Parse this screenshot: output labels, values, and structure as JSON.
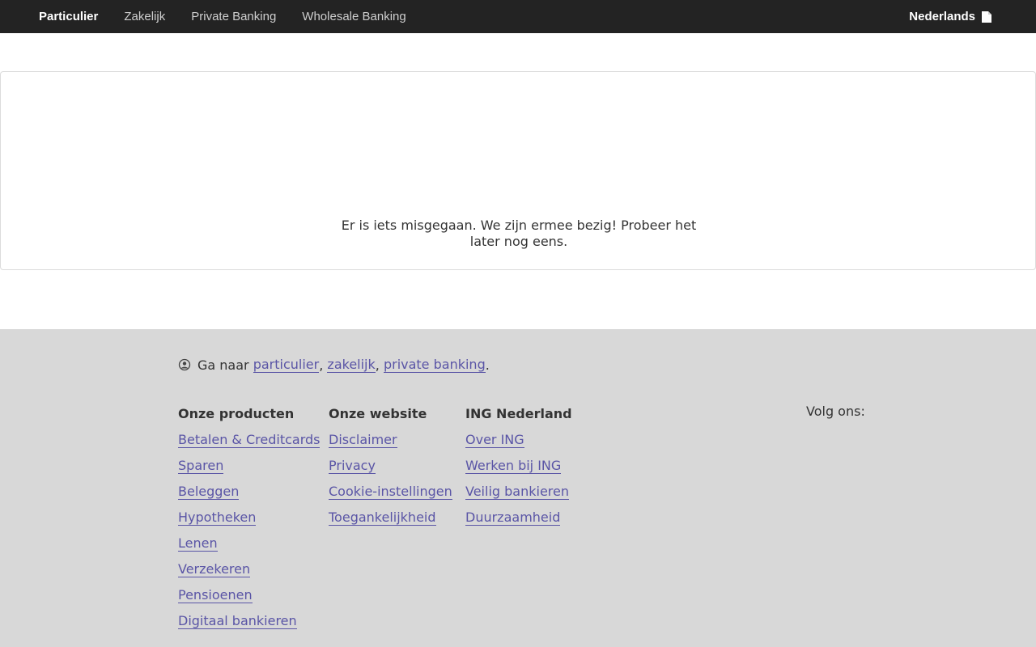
{
  "topnav": {
    "items": [
      {
        "label": "Particulier",
        "active": true
      },
      {
        "label": "Zakelijk"
      },
      {
        "label": "Private Banking"
      },
      {
        "label": "Wholesale Banking"
      }
    ],
    "language": "Nederlands",
    "language_icon": "flag-icon"
  },
  "error": {
    "message": "Er is iets misgegaan. We zijn ermee bezig! Probeer het later nog eens."
  },
  "footer": {
    "goto": {
      "icon": "user-circle-icon",
      "prefix": "Ga naar",
      "links": [
        "particulier",
        "zakelijk",
        "private banking"
      ],
      "sep": ",",
      "end": "."
    },
    "columns": [
      {
        "title": "Onze producten",
        "links": [
          "Betalen & Creditcards",
          "Sparen",
          "Beleggen",
          "Hypotheken",
          "Lenen",
          "Verzekeren",
          "Pensioenen",
          "Digitaal bankieren"
        ]
      },
      {
        "title": "Onze website",
        "links": [
          "Disclaimer",
          "Privacy",
          "Cookie-instellingen",
          "Toegankelijkheid"
        ]
      },
      {
        "title": "ING Nederland",
        "links": [
          "Over ING",
          "Werken bij ING",
          "Veilig bankieren",
          "Duurzaamheid"
        ]
      }
    ],
    "follow": "Volg ons:"
  },
  "colors": {
    "topbar": "#232323",
    "footer_bg": "#d8d8d8",
    "link": "#5a55a6"
  }
}
